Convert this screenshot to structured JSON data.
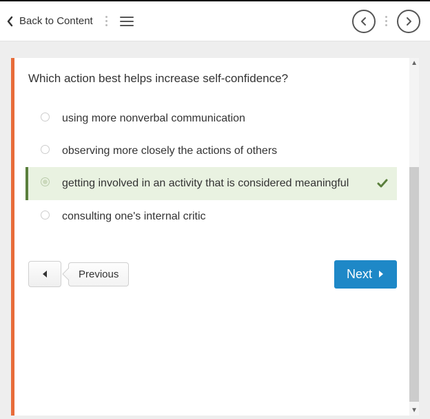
{
  "header": {
    "back_label": "Back to Content"
  },
  "question": "Which action best helps increase self-confidence?",
  "options": [
    {
      "text": "using more nonverbal communication",
      "correct": false
    },
    {
      "text": "observing more closely the actions of others",
      "correct": false
    },
    {
      "text": "getting involved in an activity that is considered meaningful",
      "correct": true
    },
    {
      "text": "consulting one's internal critic",
      "correct": false
    }
  ],
  "nav": {
    "previous_label": "Previous",
    "next_label": "Next"
  }
}
